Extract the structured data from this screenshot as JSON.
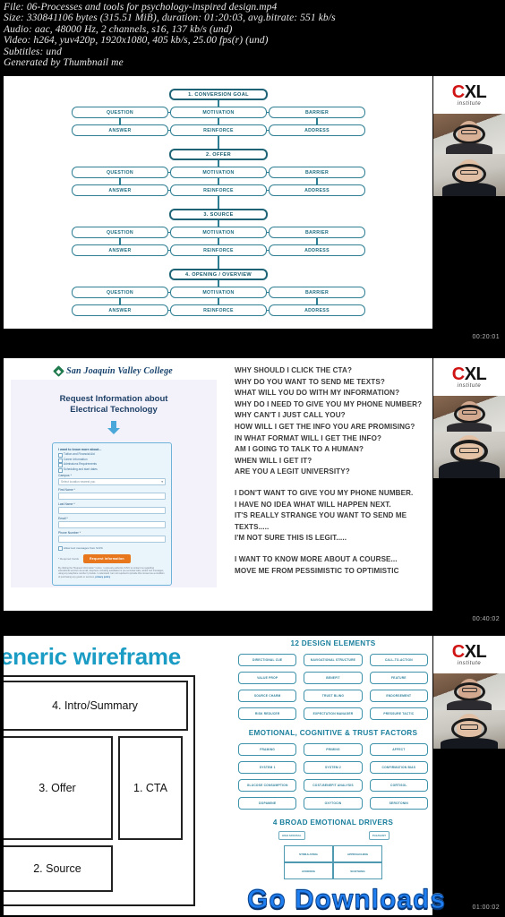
{
  "file_meta": {
    "lines": [
      "File: 06-Processes and tools for psychology-inspired design.mp4",
      "Size: 330841106 bytes (315.51 MiB), duration: 01:20:03, avg.bitrate: 551 kb/s",
      "Audio: aac, 48000 Hz, 2 channels, s16, 137 kb/s (und)",
      "Video: h264, yuv420p, 1920x1080, 405 kb/s, 25.00 fps(r) (und)",
      "Subtitles: und",
      "Generated by Thumbnail me"
    ]
  },
  "brand": {
    "logo_c": "C",
    "logo_xl": "XL",
    "logo_sub": "institute",
    "logo_red": "#d01313"
  },
  "thumbnails": [
    {
      "timestamp": "00:20:01"
    },
    {
      "timestamp": "00:40:02"
    },
    {
      "timestamp": "01:00:02"
    }
  ],
  "slide1": {
    "stages": [
      "1. CONVERSION GOAL",
      "2. OFFER",
      "3. SOURCE",
      "4. OPENING / OVERVIEW"
    ],
    "row_top": [
      "QUESTION",
      "MOTIVATION",
      "BARRIER"
    ],
    "row_bottom": [
      "ANSWER",
      "REINFORCE",
      "ADDRESS"
    ],
    "accent": "#2e7f94"
  },
  "slide2": {
    "sjvc": {
      "college_name": "San Joaquin Valley College",
      "heading_line1": "Request Information about",
      "heading_line2": "Electrical Technology",
      "form_lead": "I want to know more about...",
      "checkboxes": [
        "Tuition and Financial Aid",
        "Career Information",
        "Admissions Requirements",
        "Scheduling and start dates"
      ],
      "fields": [
        {
          "label": "Campus *",
          "value": "Select location nearest you",
          "type": "select"
        },
        {
          "label": "First Name *",
          "value": "",
          "type": "text"
        },
        {
          "label": "Last Name *",
          "value": "",
          "type": "text"
        },
        {
          "label": "Email *",
          "value": "",
          "type": "text"
        },
        {
          "label": "Phone Number *",
          "value": "",
          "type": "text"
        }
      ],
      "optin": "Allow text messages from SJVC",
      "required_note": "* Required Fields",
      "submit_label": "Request Information",
      "fine_print": "By clicking the \"Request Information\" button, I expressly authorize SJVC to contact me regarding educational services via email, telephone including autodialed or pre-recorded calls, and/or text messages, using any telephone number I provide. I understand I am not required to provide this consent as a condition of purchasing any goods or services.",
      "fine_link": "privacy policy"
    },
    "questions": [
      "WHY SHOULD I CLICK THE CTA?",
      "WHY DO YOU WANT TO SEND ME TEXTS?",
      "WHAT WILL YOU DO WITH MY INFORMATION?",
      "WHY DO I NEED TO GIVE YOU MY PHONE NUMBER?",
      "WHY CAN'T I JUST CALL YOU?",
      "HOW WILL I GET THE INFO YOU ARE PROMISING?",
      "IN WHAT FORMAT WILL I GET THE INFO?",
      "AM I GOING TO TALK TO A HUMAN?",
      "WHEN WILL I GET IT?",
      "ARE YOU A LEGIT UNIVERSITY?"
    ],
    "objections": [
      "I DON'T WANT TO GIVE YOU MY PHONE NUMBER.",
      "I HAVE NO IDEA WHAT WILL HAPPEN NEXT.",
      "IT'S REALLY STRANGE YOU WANT TO SEND ME TEXTS.....",
      "I'M NOT SURE THIS IS LEGIT....."
    ],
    "goals": [
      "I WANT TO KNOW MORE ABOUT A COURSE...",
      "MOVE ME FROM PESSIMISTIC TO OPTIMISTIC"
    ]
  },
  "slide3": {
    "wireframe_title": "eneric wireframe",
    "wireframe_boxes": [
      {
        "label": "4. Intro/Summary"
      },
      {
        "label": "3. Offer"
      },
      {
        "label": "1. CTA"
      },
      {
        "label": "2. Source"
      }
    ],
    "design_elements_title": "12 DESIGN ELEMENTS",
    "design_elements": [
      "DIRECTIONAL CUE",
      "NAVIGATIONAL STRUCTURE",
      "CALL-TO-ACTION",
      "VALUE PROP",
      "BENEFIT",
      "FEATURE",
      "SOURCE CHARM",
      "TRUST BLING",
      "ENDORSEMENT",
      "RISK REDUCER",
      "EXPECTATION MANAGER",
      "PRESSURE TACTIC"
    ],
    "factors_title": "EMOTIONAL, COGNITIVE & TRUST FACTORS",
    "factors": [
      "FRAMING",
      "PRIMING",
      "AFFECT",
      "SYSTEM 1",
      "SYSTEM 2",
      "CONFIRMATION BIAS",
      "GLUCOSE CONSUMPTION",
      "COST-BENEFIT ANALYSIS",
      "CORTISOL",
      "DOPAMINE",
      "OXYTOCIN",
      "SEROTONIN"
    ],
    "drivers_title": "4 BROAD EMOTIONAL DRIVERS",
    "drivers": [
      "STIMULATING",
      "APPROACHING",
      "AVOIDING",
      "SOOTHING"
    ],
    "driver_callouts": [
      "HIGH AROUSAL",
      "PLEASANT"
    ],
    "accent": "#1b9cc4"
  },
  "watermark": {
    "text": "Go Downloads",
    "color": "#1f7ef0"
  }
}
